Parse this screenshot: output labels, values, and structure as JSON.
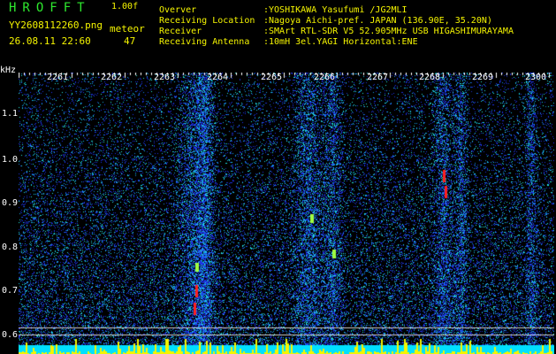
{
  "header": {
    "app_title": "HROFFT",
    "version": "1.00f",
    "filename": "YY2608112260.png",
    "datetime": "26.08.11 22:60",
    "meteor_label": "meteor",
    "meteor_count": "47"
  },
  "info": [
    {
      "label": "Overver",
      "value": ":YOSHIKAWA Yasufumi /JG2MLI"
    },
    {
      "label": "Receiving Location",
      "value": ":Nagoya Aichi-pref. JAPAN (136.90E, 35.20N)"
    },
    {
      "label": "Receiver",
      "value": ":SMArt RTL-SDR V5 52.905MHz USB HIGASHIMURAYAMA"
    },
    {
      "label": "Receiving Antenna",
      "value": ":10mH 3el.YAGI Horizontal:ENE"
    }
  ],
  "spectrogram": {
    "freq_unit": "kHz",
    "y_ticks": [
      "1.1",
      "1.0",
      "0.9",
      "0.8",
      "0.7",
      "0.6"
    ],
    "x_ticks": [
      "2261",
      "2262",
      "2263",
      "2264",
      "2265",
      "2266",
      "2267",
      "2268",
      "2269",
      "2300"
    ],
    "colors": {
      "noise": "#2a3cd8",
      "peak": "#ff2020",
      "mid": "#20e0e0",
      "baseline": "#00e0ff",
      "burst": "#f5f500"
    }
  }
}
